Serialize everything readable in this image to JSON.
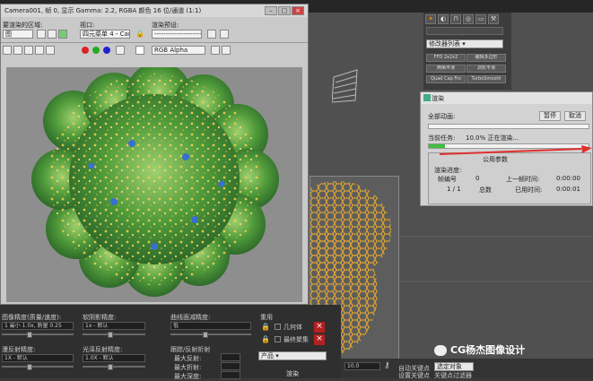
{
  "framebuffer": {
    "title": "Camera001, 帧 0, 显示 Gamma: 2.2, RGBA 颜色 16 位/通道 (1:1)",
    "area_label": "要渲染的区域:",
    "area_value": "图",
    "viewport_label": "视口:",
    "viewport_value": "四元菜单 4 - Can",
    "preset_label": "渲染预设:",
    "preset_value": "----------------------",
    "channel_value": "RGB Alpha"
  },
  "render_dialog": {
    "title": "渲染",
    "total_anim_label": "全部动画:",
    "pause_label": "暂停",
    "cancel_label": "取消",
    "current_task_label": "当前任务:",
    "current_task_value": "10.0% 正在渲染...",
    "progress_percent": 10,
    "common_params_label": "公用参数",
    "render_progress_label": "渲染进度:",
    "frame_label": "帧编号",
    "frame_value": "0",
    "last_frame_time_label": "上一帧时间:",
    "last_frame_time_value": "0:00:00",
    "count_value": "1 / 1",
    "total_label": "总数",
    "elapsed_label": "已用时间:",
    "elapsed_value": "0:00:01"
  },
  "command_panel": {
    "modifier_list": "修改器列表",
    "buttons": [
      "FFD 2x2x2",
      "编辑多边形",
      "两栖平滑",
      "涡轮平滑",
      "Quad Cap Fro",
      "TurboSmooth"
    ]
  },
  "bottom_panel": {
    "image_precision_label": "图像精度(质量/速度):",
    "image_precision_value": "1 最小 1.0x, 质量 0.25",
    "antialias_label": "软阴影精度:",
    "antialias_value": "1x - 默认",
    "global_precision_label": "曲线面减精度:",
    "global_precision_value": "低",
    "reflect_label": "漫反射精度:",
    "reflect_value": "1.0X - 默认",
    "refract_label": "光泽反射精度:",
    "refract_value": "1.0X - 默认",
    "trace_label": "跟踪/反射折射",
    "max_depth_label": "最大反射:",
    "max_refl_label": "最大折射:",
    "max_depth_value": "",
    "trace_bounces_label": "最大深度:",
    "reuse_label": "重用",
    "geometry_label": "几何体",
    "final_gather_label": "最终聚集",
    "product_value": "产品",
    "render_button": "渲染",
    "default_a": "1X - 默认",
    "default_b": "1X - 默认"
  },
  "status_bar": {
    "field_value": "10.0",
    "auto_key_label": "自动关键点",
    "selected_label": "选定对象",
    "set_key_label": "设置关键点",
    "filters_label": "关键点过滤器"
  },
  "watermark": {
    "text": "CG杨杰图像设计"
  },
  "colors": {
    "accent_green": "#3fbf3f",
    "red_arrow": "#e03030",
    "close_red": "#b42020"
  }
}
